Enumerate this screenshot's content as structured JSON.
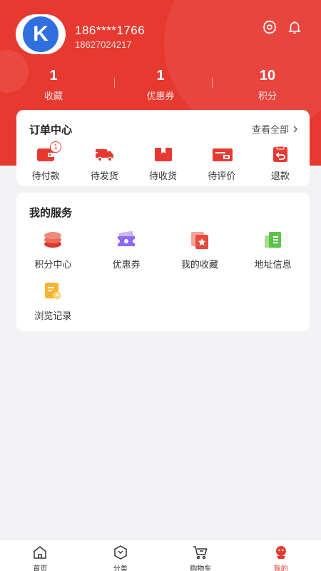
{
  "profile": {
    "avatar_letter": "K",
    "name": "186****1766",
    "phone": "18627024217"
  },
  "header_icons": [
    "gear-icon",
    "bell-icon"
  ],
  "stats": [
    {
      "value": "1",
      "label": "收藏"
    },
    {
      "value": "1",
      "label": "优惠券"
    },
    {
      "value": "10",
      "label": "积分"
    }
  ],
  "orders": {
    "title": "订单中心",
    "view_all": "查看全部",
    "items": [
      {
        "label": "待付款",
        "icon": "wallet-icon",
        "badge": "1"
      },
      {
        "label": "待发货",
        "icon": "truck-icon"
      },
      {
        "label": "待收货",
        "icon": "box-icon"
      },
      {
        "label": "待评价",
        "icon": "comment-icon"
      },
      {
        "label": "退款",
        "icon": "refund-icon"
      }
    ]
  },
  "services": {
    "title": "我的服务",
    "items": [
      {
        "label": "积分中心",
        "icon": "coins-icon"
      },
      {
        "label": "优惠券",
        "icon": "ticket-icon"
      },
      {
        "label": "我的收藏",
        "icon": "star-folder-icon"
      },
      {
        "label": "地址信息",
        "icon": "address-icon"
      },
      {
        "label": "浏览记录",
        "icon": "history-icon"
      }
    ]
  },
  "tabbar": [
    {
      "label": "首页",
      "icon": "home-icon",
      "active": false
    },
    {
      "label": "分类",
      "icon": "category-icon",
      "active": false
    },
    {
      "label": "购物车",
      "icon": "cart-icon",
      "active": false
    },
    {
      "label": "我的",
      "icon": "mine-icon",
      "active": true
    }
  ],
  "colors": {
    "brand_red": "#e63a31",
    "avatar_blue": "#2f6fde",
    "background": "#f3f3f5"
  }
}
